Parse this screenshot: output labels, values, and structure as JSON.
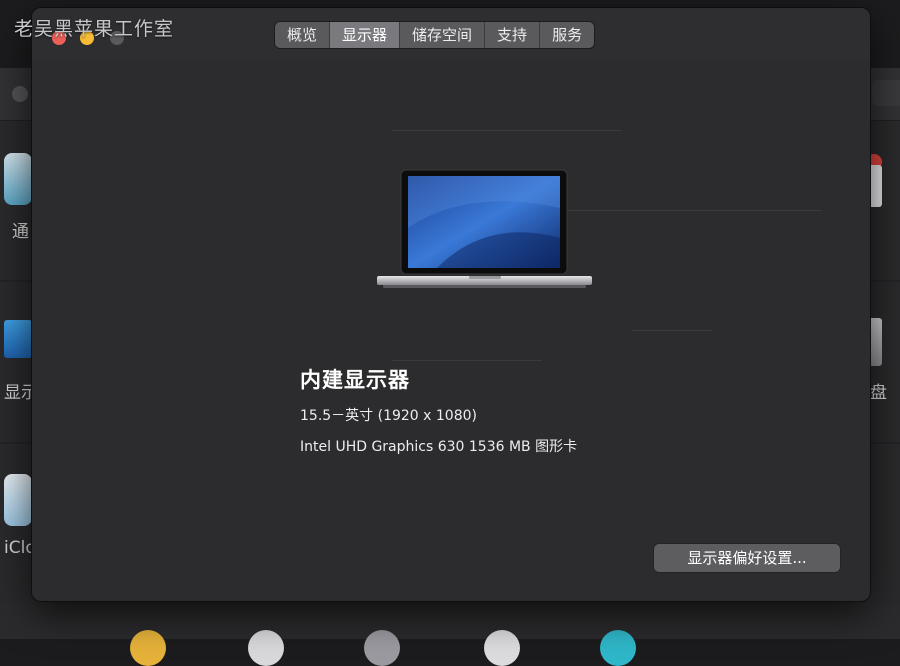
{
  "watermark": "老吴黑苹果工作室",
  "window": {
    "tabs": [
      {
        "label": "概览",
        "active": false
      },
      {
        "label": "显示器",
        "active": true
      },
      {
        "label": "储存空间",
        "active": false
      },
      {
        "label": "支持",
        "active": false
      },
      {
        "label": "服务",
        "active": false
      }
    ]
  },
  "display": {
    "name": "内建显示器",
    "size": "15.5－英寸 (1920 x 1080)",
    "graphics": "Intel UHD Graphics 630 1536 MB 图形卡"
  },
  "actions": {
    "preferences_label": "显示器偏好设置..."
  },
  "background": {
    "left_labels": [
      "通",
      "显示",
      "iClo"
    ],
    "right_label": "盘"
  },
  "colors": {
    "close": "#ee5f58",
    "minimize": "#f7bc33",
    "dialog_bg": "#2c2c2e",
    "active_tab": "#7a7a7e"
  }
}
